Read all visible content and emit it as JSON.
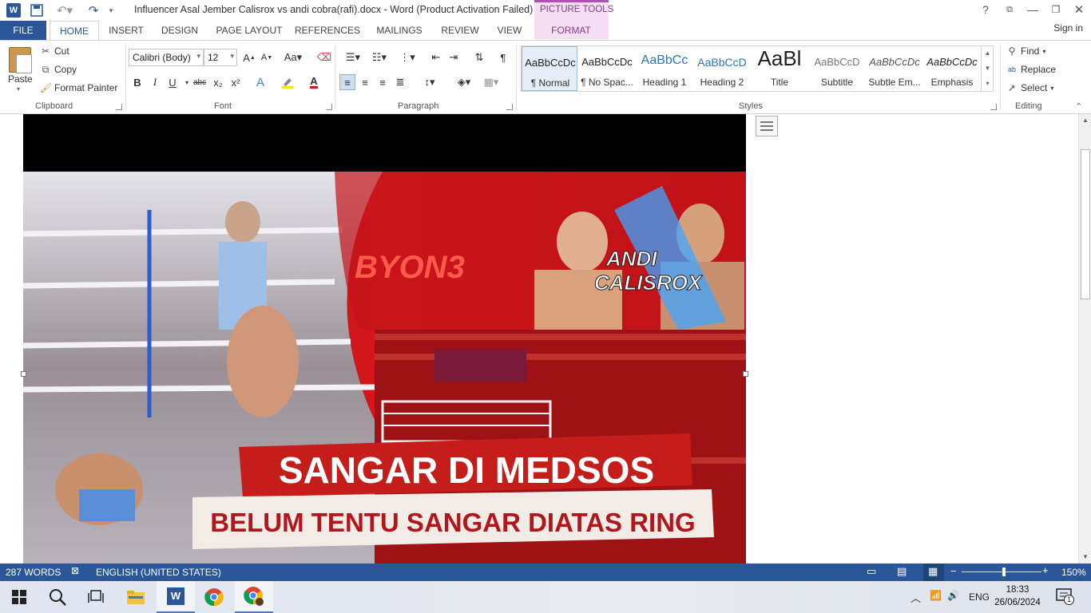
{
  "window": {
    "title": "Influencer Asal Jember Calisrox vs andi cobra(rafi).docx - Word (Product Activation Failed)",
    "context_tab_group": "PICTURE TOOLS"
  },
  "tabs": [
    {
      "label": "FILE"
    },
    {
      "label": "HOME"
    },
    {
      "label": "INSERT"
    },
    {
      "label": "DESIGN"
    },
    {
      "label": "PAGE LAYOUT"
    },
    {
      "label": "REFERENCES"
    },
    {
      "label": "MAILINGS"
    },
    {
      "label": "REVIEW"
    },
    {
      "label": "VIEW"
    },
    {
      "label": "FORMAT"
    }
  ],
  "signin": "Sign in",
  "clipboard": {
    "paste": "Paste",
    "cut": "Cut",
    "copy": "Copy",
    "format_painter": "Format Painter",
    "label": "Clipboard"
  },
  "font": {
    "name": "Calibri (Body)",
    "size": "12",
    "label": "Font",
    "bold": "B",
    "italic": "I",
    "underline": "U",
    "strike": "abc",
    "sub": "x₂",
    "sup": "x²"
  },
  "paragraph": {
    "label": "Paragraph"
  },
  "styles": {
    "label": "Styles",
    "items": [
      {
        "preview": "AaBbCcDc",
        "name": "¶ Normal"
      },
      {
        "preview": "AaBbCcDc",
        "name": "¶ No Spac..."
      },
      {
        "preview": "AaBbCc",
        "name": "Heading 1"
      },
      {
        "preview": "AaBbCcD",
        "name": "Heading 2"
      },
      {
        "preview": "AaBl",
        "name": "Title"
      },
      {
        "preview": "AaBbCcD",
        "name": "Subtitle"
      },
      {
        "preview": "AaBbCcDc",
        "name": "Subtle Em..."
      },
      {
        "preview": "AaBbCcDc",
        "name": "Emphasis"
      }
    ]
  },
  "editing": {
    "label": "Editing",
    "find": "Find",
    "replace": "Replace",
    "select": "Select"
  },
  "image": {
    "brand": "BYON3",
    "fighters": "ANDI CALISROX",
    "headline": "SANGAR DI MEDSOS",
    "subline": "BELUM TENTU SANGAR DIATAS RING",
    "accent": "#d8171b"
  },
  "status": {
    "words": "287 WORDS",
    "language": "ENGLISH (UNITED STATES)",
    "zoom": "150%"
  },
  "tray": {
    "lang": "ENG",
    "time": "18:33",
    "date": "26/06/2024",
    "notifications": "1"
  }
}
